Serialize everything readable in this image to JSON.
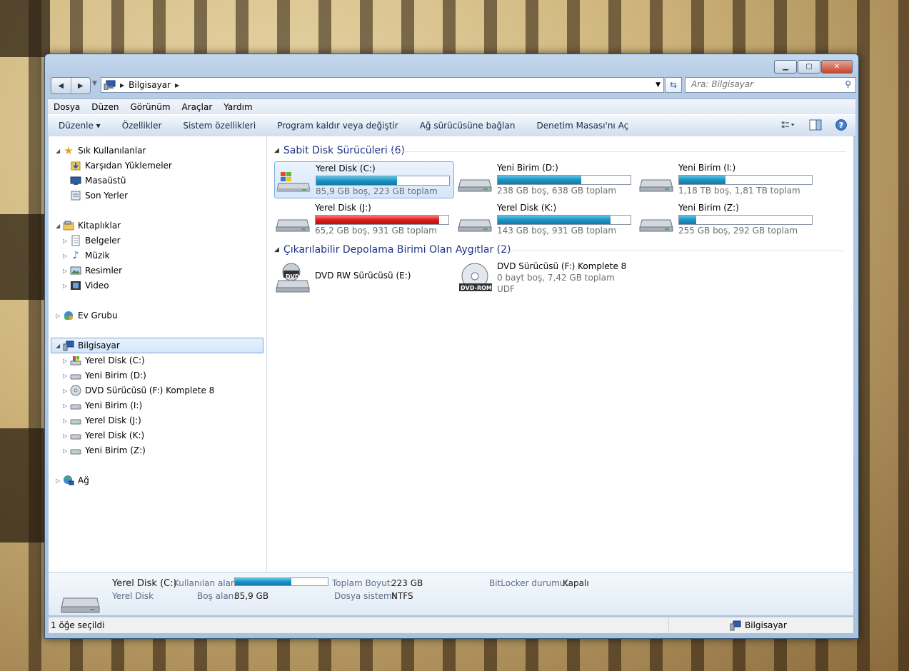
{
  "window": {
    "min": "▁",
    "max": "▢",
    "close": "✕"
  },
  "address": {
    "location": "Bilgisayar",
    "search_placeholder": "Ara: Bilgisayar"
  },
  "menu": [
    "Dosya",
    "Düzen",
    "Görünüm",
    "Araçlar",
    "Yardım"
  ],
  "toolbar": [
    "Düzenle ▾",
    "Özellikler",
    "Sistem özellikleri",
    "Program kaldır veya değiştir",
    "Ağ sürücüsüne bağlan",
    "Denetim Masası'nı Aç"
  ],
  "nav": {
    "favorites": {
      "label": "Sık Kullanılanlar",
      "items": [
        "Karşıdan Yüklemeler",
        "Masaüstü",
        "Son Yerler"
      ]
    },
    "libraries": {
      "label": "Kitaplıklar",
      "items": [
        "Belgeler",
        "Müzik",
        "Resimler",
        "Video"
      ]
    },
    "homegroup": "Ev Grubu",
    "computer": {
      "label": "Bilgisayar",
      "items": [
        "Yerel Disk (C:)",
        "Yeni Birim (D:)",
        "DVD Sürücüsü (F:) Komplete 8",
        "Yeni Birim (I:)",
        "Yerel Disk (J:)",
        "Yerel Disk (K:)",
        "Yeni Birim (Z:)"
      ]
    },
    "network": "Ağ"
  },
  "groups": {
    "hdd": "Sabit Disk Sürücüleri (6)",
    "removable": "Çıkarılabilir Depolama Birimi Olan Aygıtlar (2)"
  },
  "drives": [
    {
      "name": "Yerel Disk (C:)",
      "info": "85,9 GB boş, 223 GB toplam",
      "used_fraction": 0.61,
      "bar_color": "#1c93c4"
    },
    {
      "name": "Yeni Birim (D:)",
      "info": "238 GB boş, 638 GB toplam",
      "used_fraction": 0.63,
      "bar_color": "#1c93c4"
    },
    {
      "name": "Yeni Birim (I:)",
      "info": "1,18 TB boş, 1,81 TB toplam",
      "used_fraction": 0.35,
      "bar_color": "#1c93c4"
    },
    {
      "name": "Yerel Disk (J:)",
      "info": "65,2 GB boş, 931 GB toplam",
      "used_fraction": 0.93,
      "bar_color": "#dc1d1d"
    },
    {
      "name": "Yerel Disk (K:)",
      "info": "143 GB boş, 931 GB toplam",
      "used_fraction": 0.85,
      "bar_color": "#1c93c4"
    },
    {
      "name": "Yeni Birim (Z:)",
      "info": "255 GB boş, 292 GB toplam",
      "used_fraction": 0.13,
      "bar_color": "#1c93c4"
    }
  ],
  "removables": [
    {
      "name": "DVD RW Sürücüsü (E:)",
      "label": "DVD"
    },
    {
      "name": "DVD Sürücüsü (F:) Komplete 8",
      "info": "0 bayt boş, 7,42 GB toplam",
      "fs": "UDF",
      "label": "DVD-ROM"
    }
  ],
  "details": {
    "title": "Yerel Disk (C:)",
    "subtitle": "Yerel Disk",
    "used_label": "Kullanılan alan:",
    "used_fraction": 0.61,
    "free_label": "Boş alan:",
    "free_value": "85,9 GB",
    "total_label": "Toplam Boyut:",
    "total_value": "223 GB",
    "fs_label": "Dosya sistemi:",
    "fs_value": "NTFS",
    "bitlocker_label": "BitLocker durumu:",
    "bitlocker_value": "Kapalı"
  },
  "status": {
    "selection": "1 öğe seçildi",
    "location": "Bilgisayar"
  }
}
